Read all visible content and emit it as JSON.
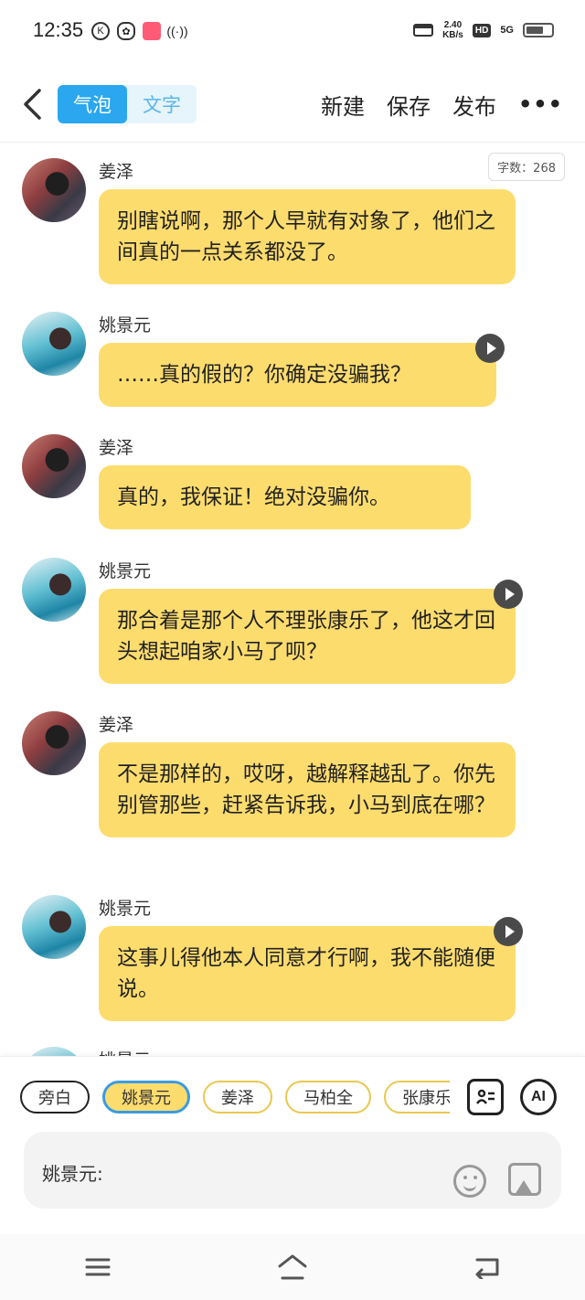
{
  "status_bar": {
    "time": "12:35",
    "left_icons": [
      "K",
      "wechat",
      "app",
      "hotspot"
    ],
    "net_speed_value": "2.40",
    "net_speed_unit": "KB/s",
    "hd_label": "HD",
    "network": "5G",
    "battery_level": 0.7
  },
  "header": {
    "toggle": [
      {
        "label": "气泡",
        "active": true
      },
      {
        "label": "文字",
        "active": false
      }
    ],
    "actions": [
      {
        "label": "新建"
      },
      {
        "label": "保存"
      },
      {
        "label": "发布"
      }
    ],
    "more_label": "•••"
  },
  "word_count_label": "字数：268",
  "messages": [
    {
      "speaker": "姜泽",
      "avatar": "jiang",
      "text": "别瞎说啊，那个人早就有对象了，他们之间真的一点关系都没了。",
      "audio": false
    },
    {
      "speaker": "姚景元",
      "avatar": "yao",
      "text": "……真的假的？你确定没骗我？",
      "audio": true
    },
    {
      "speaker": "姜泽",
      "avatar": "jiang",
      "text": "真的，我保证！绝对没骗你。",
      "audio": false
    },
    {
      "speaker": "姚景元",
      "avatar": "yao",
      "text": "那合着是那个人不理张康乐了，他这才回头想起咱家小马了呗？",
      "audio": true
    },
    {
      "speaker": "姜泽",
      "avatar": "jiang",
      "text": "不是那样的，哎呀，越解释越乱了。你先别管那些，赶紧告诉我，小马到底在哪？",
      "audio": false
    },
    {
      "speaker": "姚景元",
      "avatar": "yao",
      "text": "这事儿得他本人同意才行啊，我不能随便说。",
      "audio": true
    },
    {
      "speaker": "姚景元",
      "avatar": "yao",
      "text": "",
      "audio": false
    }
  ],
  "role_chips": [
    {
      "label": "旁白",
      "type": "narration"
    },
    {
      "label": "姚景元",
      "type": "selected"
    },
    {
      "label": "姜泽",
      "type": "normal"
    },
    {
      "label": "马柏全",
      "type": "normal"
    },
    {
      "label": "张康乐",
      "type": "normal"
    }
  ],
  "ai_label": "AI",
  "input": {
    "label": "姚景元:"
  },
  "colors": {
    "bubble": "#fddc6e",
    "accent": "#2aa7ee",
    "chip_border": "#e9c84f"
  },
  "nav": [
    "menu-icon",
    "home-icon",
    "back-icon"
  ]
}
